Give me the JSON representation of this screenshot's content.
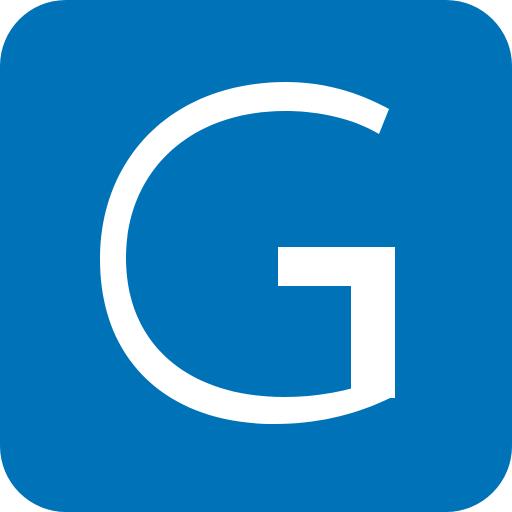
{
  "icon": {
    "letter": "G",
    "background_color": "#0072B8",
    "glyph_color": "#FFFFFF"
  }
}
